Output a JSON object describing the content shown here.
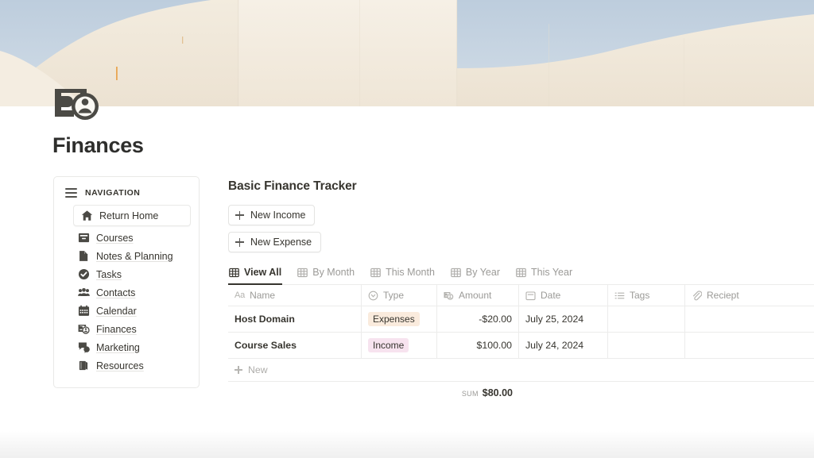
{
  "cover": {
    "sky_color": "#c5d3e1",
    "wall_color": "#f1e8da",
    "accent_color": "#e79a3c"
  },
  "page": {
    "icon": "money-person-icon",
    "title": "Finances"
  },
  "sidebar": {
    "header_label": "NAVIGATION",
    "menu_icon": "hamburger-icon",
    "items": [
      {
        "label": "Return Home",
        "icon": "home-icon",
        "boxed": true
      },
      {
        "label": "Courses",
        "icon": "archive-box-icon",
        "boxed": false
      },
      {
        "label": "Notes & Planning",
        "icon": "document-icon",
        "boxed": false
      },
      {
        "label": "Tasks",
        "icon": "check-circle-icon",
        "boxed": false
      },
      {
        "label": "Contacts",
        "icon": "people-group-icon",
        "boxed": false
      },
      {
        "label": "Calendar",
        "icon": "calendar-icon",
        "boxed": false
      },
      {
        "label": "Finances",
        "icon": "money-person-icon",
        "boxed": false
      },
      {
        "label": "Marketing",
        "icon": "speech-bubbles-icon",
        "boxed": false
      },
      {
        "label": "Resources",
        "icon": "books-icon",
        "boxed": false
      }
    ]
  },
  "main": {
    "database_title": "Basic Finance Tracker",
    "buttons": [
      {
        "label": "New Income",
        "icon": "plus-icon"
      },
      {
        "label": "New Expense",
        "icon": "plus-icon"
      }
    ],
    "tabs": [
      {
        "label": "View All",
        "icon": "table-grid-icon",
        "active": true
      },
      {
        "label": "By Month",
        "icon": "table-grid-icon",
        "active": false
      },
      {
        "label": "This Month",
        "icon": "table-grid-icon",
        "active": false
      },
      {
        "label": "By Year",
        "icon": "table-grid-icon",
        "active": false
      },
      {
        "label": "This Year",
        "icon": "table-grid-icon",
        "active": false
      }
    ],
    "table": {
      "columns": [
        {
          "label": "Name",
          "icon": "text-aa-icon"
        },
        {
          "label": "Type",
          "icon": "select-circle-icon"
        },
        {
          "label": "Amount",
          "icon": "money-person-icon"
        },
        {
          "label": "Date",
          "icon": "calendar-icon"
        },
        {
          "label": "Tags",
          "icon": "multiselect-list-icon"
        },
        {
          "label": "Reciept",
          "icon": "paperclip-icon"
        }
      ],
      "rows": [
        {
          "name": "Host Domain",
          "type": "Expenses",
          "type_style": "expenses",
          "amount": "-$20.00",
          "date": "July 25, 2024",
          "tags": "",
          "receipt": ""
        },
        {
          "name": "Course Sales",
          "type": "Income",
          "type_style": "income",
          "amount": "$100.00",
          "date": "July 24, 2024",
          "tags": "",
          "receipt": ""
        }
      ],
      "new_row_label": "New",
      "sum_label": "SUM",
      "sum_value": "$80.00"
    }
  },
  "colors": {
    "expenses_pill_bg": "#faebdd",
    "income_pill_bg": "#f7e3ef",
    "text_primary": "#37352f",
    "text_muted": "#9b9a97",
    "border": "#ececeb"
  }
}
